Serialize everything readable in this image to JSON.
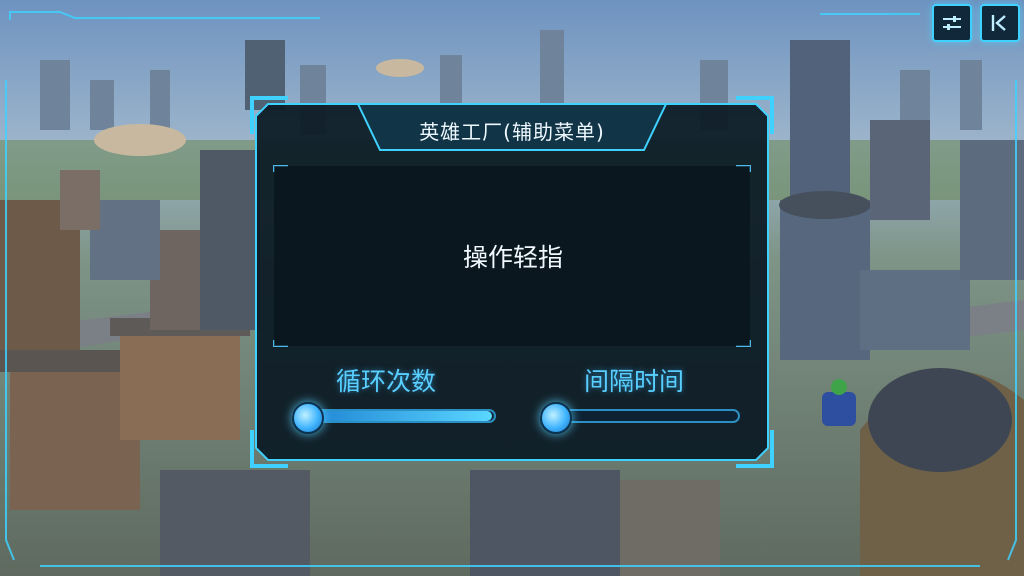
{
  "panel": {
    "title": "英雄工厂(辅助菜单)",
    "info_text": "操作轻指"
  },
  "controls": {
    "loop_count": {
      "label": "循环次数",
      "level": 0.99
    },
    "interval_time": {
      "label": "间隔时间",
      "level": 0.0
    }
  },
  "top_buttons": [
    {
      "icon": "sliders-icon"
    },
    {
      "icon": "collapse-icon"
    }
  ],
  "colors": {
    "accent": "#3fd1ff",
    "panel_bg": "#0b1a24",
    "label": "#58cfff"
  }
}
